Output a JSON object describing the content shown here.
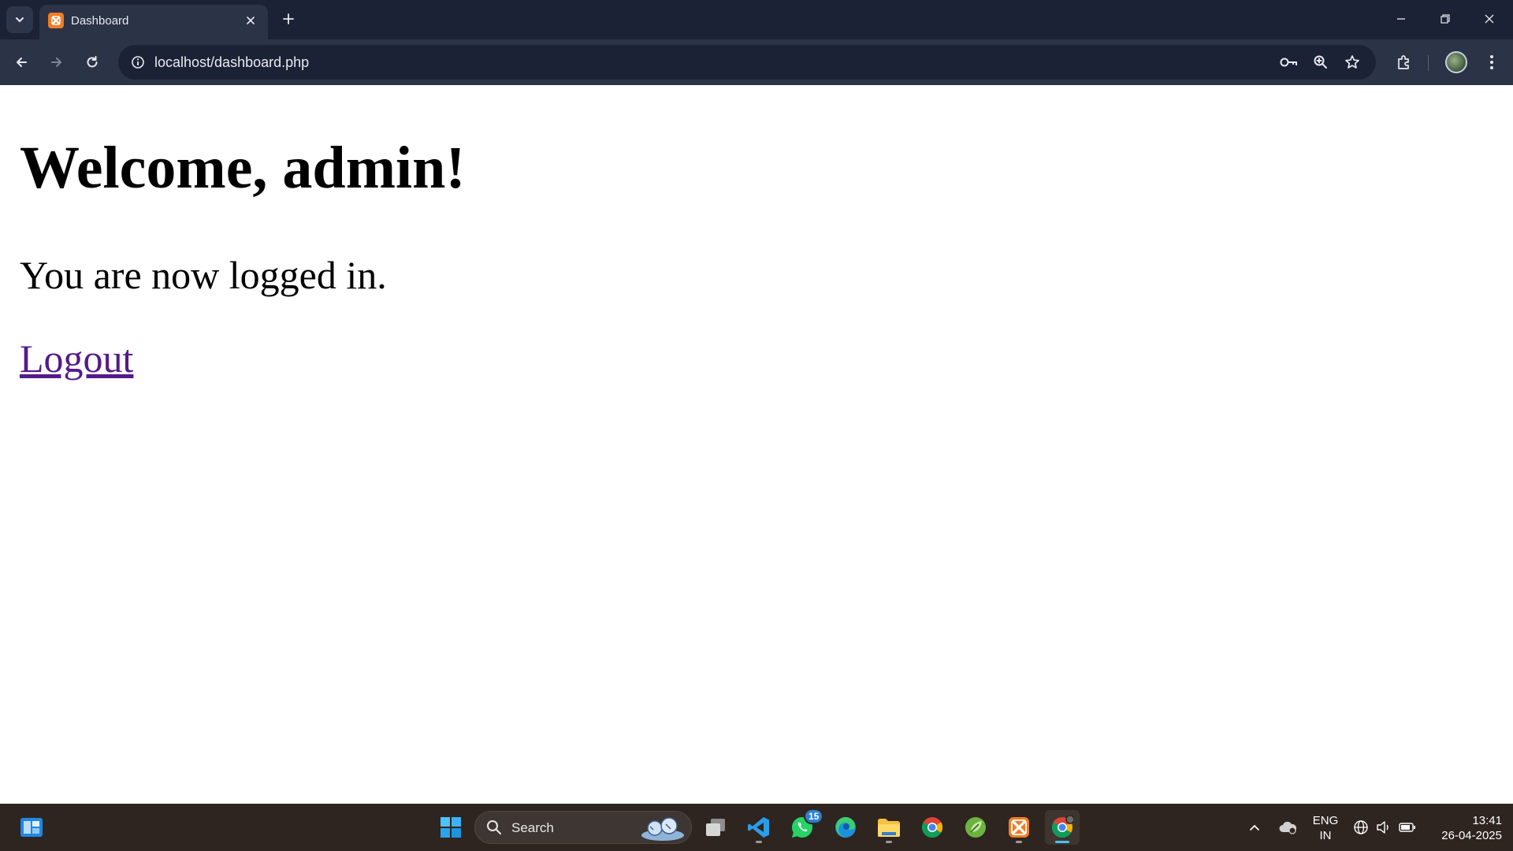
{
  "browser": {
    "tab": {
      "title": "Dashboard"
    },
    "address_bar": {
      "url": "localhost/dashboard.php"
    },
    "icons": [
      "tab-search-icon",
      "close-icon",
      "plus-icon",
      "minimize-icon",
      "restore-icon",
      "back-icon",
      "forward-icon",
      "reload-icon",
      "site-info-icon",
      "key-icon",
      "zoom-icon",
      "star-icon",
      "extensions-icon",
      "more-icon"
    ]
  },
  "page": {
    "heading": "Welcome, admin!",
    "message": "You are now logged in.",
    "logout_link": "Logout",
    "link_color": "#551a8b"
  },
  "taskbar": {
    "search": {
      "label": "Search"
    },
    "apps": [
      {
        "name": "start",
        "icon": "windows-icon"
      },
      {
        "name": "task-view",
        "icon": "task-view-icon"
      },
      {
        "name": "vscode",
        "icon": "vscode-icon",
        "running": true
      },
      {
        "name": "whatsapp",
        "icon": "whatsapp-icon",
        "badge": "15"
      },
      {
        "name": "edge",
        "icon": "edge-icon"
      },
      {
        "name": "file-explorer",
        "icon": "folder-icon",
        "running": true
      },
      {
        "name": "chrome",
        "icon": "chrome-icon"
      },
      {
        "name": "spring-tool",
        "icon": "spring-icon"
      },
      {
        "name": "xampp",
        "icon": "xampp-icon",
        "running": true
      },
      {
        "name": "chrome-active",
        "icon": "chrome-icon",
        "active": true
      }
    ],
    "tray": {
      "language_line1": "ENG",
      "language_line2": "IN",
      "time": "13:41",
      "date": "26-04-2025"
    }
  },
  "colors": {
    "tabstrip_bg": "#1b2235",
    "toolbar_bg": "#2b3346",
    "taskbar_bg": "#2e2520",
    "xampp_orange": "#f07d24",
    "active_indicator": "#4cc2ff"
  }
}
